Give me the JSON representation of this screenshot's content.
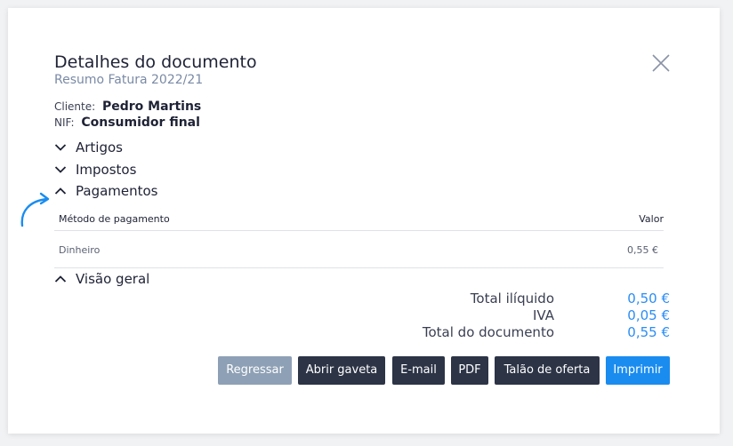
{
  "dialog": {
    "title": "Detalhes do documento",
    "subtitle": "Resumo Fatura 2022/21"
  },
  "customer": {
    "client_label": "Cliente:",
    "client_value": "Pedro Martins",
    "nif_label": "NIF:",
    "nif_value": "Consumidor final"
  },
  "sections": {
    "artigos": "Artigos",
    "impostos": "Impostos",
    "pagamentos": "Pagamentos",
    "visao_geral": "Visão geral"
  },
  "payments_table": {
    "headers": [
      "Método de pagamento",
      "Valor"
    ],
    "rows": [
      {
        "method": "Dinheiro",
        "value": "0,55 €"
      }
    ]
  },
  "overview": {
    "total_iliquido_label": "Total ilíquido",
    "total_iliquido_value": "0,50 €",
    "iva_label": "IVA",
    "iva_value": "0,05 €",
    "total_doc_label": "Total do documento",
    "total_doc_value": "0,55 €"
  },
  "buttons": {
    "regressar": "Regressar",
    "abrir_gaveta": "Abrir gaveta",
    "email": "E-mail",
    "pdf": "PDF",
    "talao": "Talão de oferta",
    "imprimir": "Imprimir"
  },
  "colors": {
    "accent": "#1a8cf0",
    "dark_button": "#2c3446",
    "muted_button": "#8ea0b5",
    "amount_blue": "#2a8df5"
  }
}
